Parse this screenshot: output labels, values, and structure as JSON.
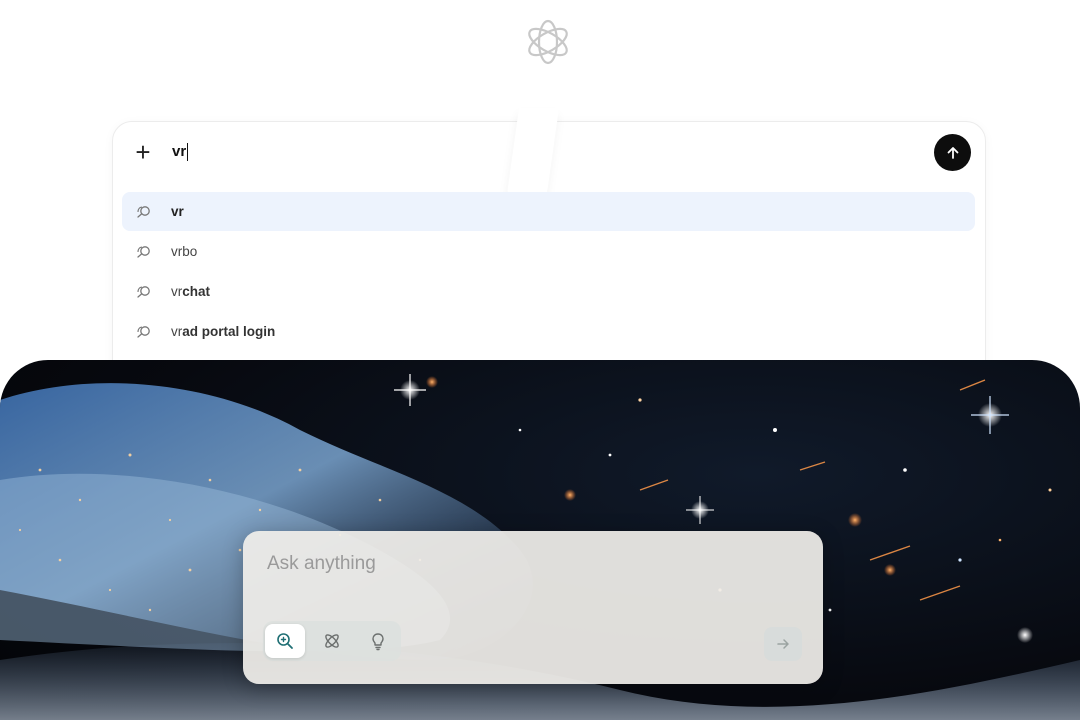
{
  "search": {
    "query": "vr",
    "suggestions": [
      {
        "prefix": "vr",
        "completion": "",
        "active": true
      },
      {
        "prefix": "vrbo",
        "completion": "",
        "active": false
      },
      {
        "prefix": "vr",
        "completion": "chat",
        "active": false
      },
      {
        "prefix": "vr",
        "completion": "ad portal login",
        "active": false
      }
    ]
  },
  "ask": {
    "placeholder": "Ask anything",
    "modes": [
      {
        "icon": "search-zoom-icon",
        "active": true
      },
      {
        "icon": "atom-icon",
        "active": false
      },
      {
        "icon": "lightbulb-icon",
        "active": false
      }
    ]
  },
  "colors": {
    "send_button": "#0d0d0d",
    "suggestion_highlight": "#edf3fd",
    "accent_teal": "#1f6f74"
  }
}
